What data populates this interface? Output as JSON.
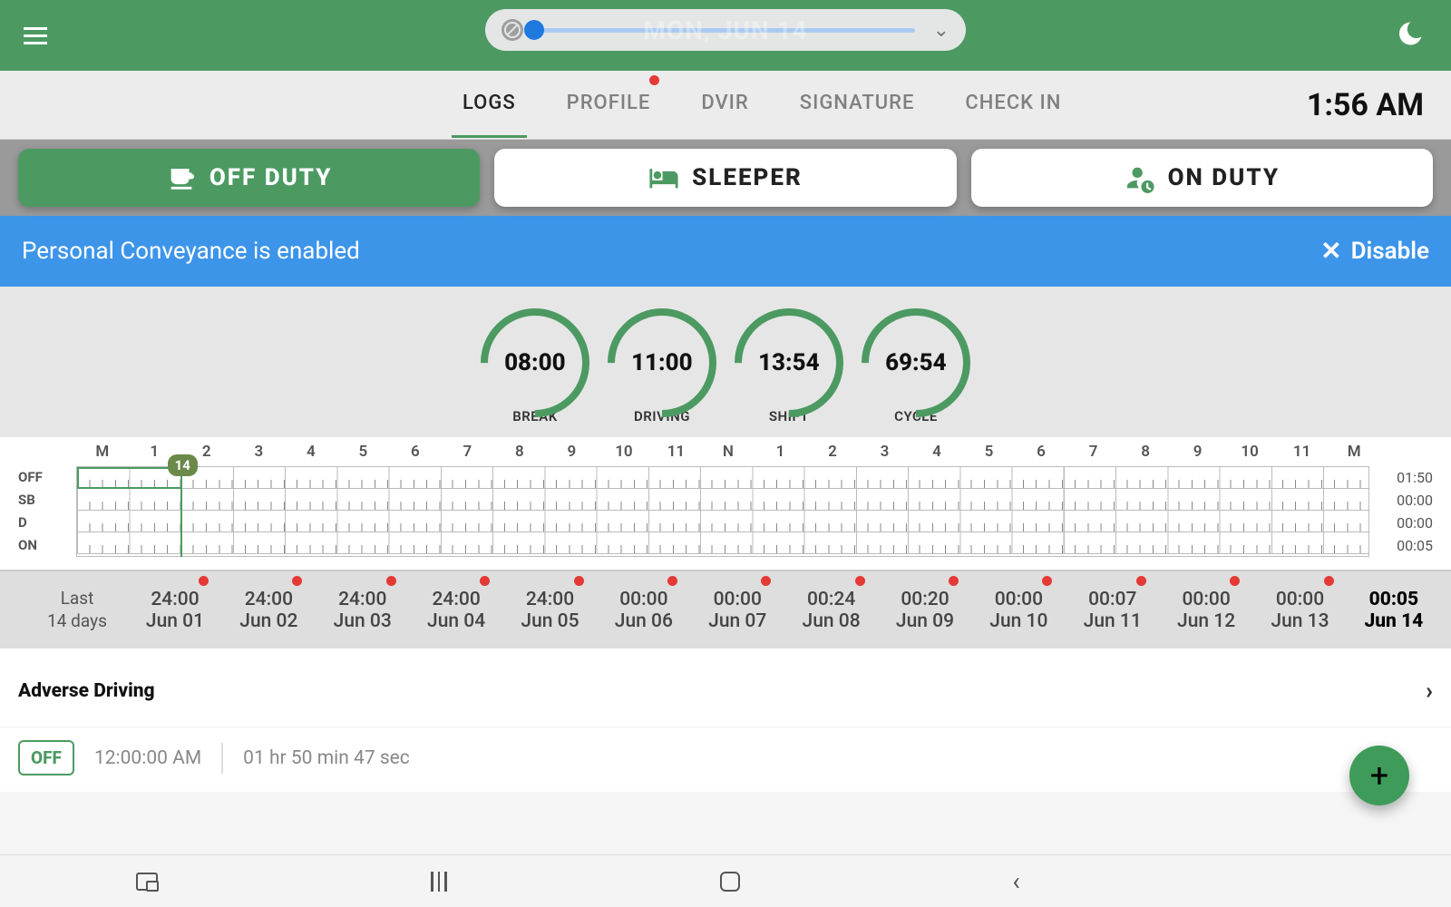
{
  "header": {
    "date_label": "MON, JUN 14"
  },
  "tabs": {
    "logs": "LOGS",
    "profile": "PROFILE",
    "dvir": "DVIR",
    "signature": "SIGNATURE",
    "checkin": "CHECK IN",
    "clock": "1:56 AM"
  },
  "status": {
    "off": "OFF DUTY",
    "sleeper": "SLEEPER",
    "on": "ON DUTY"
  },
  "banner": {
    "text": "Personal Conveyance is enabled",
    "action": "Disable"
  },
  "gauges": [
    {
      "value": "08:00",
      "label": "BREAK"
    },
    {
      "value": "11:00",
      "label": "DRIVING"
    },
    {
      "value": "13:54",
      "label": "SHIFT"
    },
    {
      "value": "69:54",
      "label": "CYCLE"
    }
  ],
  "grid": {
    "top_labels": [
      "M",
      "1",
      "2",
      "3",
      "4",
      "5",
      "6",
      "7",
      "8",
      "9",
      "10",
      "11",
      "N",
      "1",
      "2",
      "3",
      "4",
      "5",
      "6",
      "7",
      "8",
      "9",
      "10",
      "11",
      "M"
    ],
    "row_names": [
      "OFF",
      "SB",
      "D",
      "ON"
    ],
    "row_totals": [
      "01:50",
      "00:00",
      "00:00",
      "00:05"
    ],
    "badge": "14"
  },
  "strip": {
    "lead1": "Last",
    "lead2": "14 days",
    "days": [
      {
        "hrs": "24:00",
        "date": "Jun 01",
        "dot": true
      },
      {
        "hrs": "24:00",
        "date": "Jun 02",
        "dot": true
      },
      {
        "hrs": "24:00",
        "date": "Jun 03",
        "dot": true
      },
      {
        "hrs": "24:00",
        "date": "Jun 04",
        "dot": true
      },
      {
        "hrs": "24:00",
        "date": "Jun 05",
        "dot": true
      },
      {
        "hrs": "00:00",
        "date": "Jun 06",
        "dot": true
      },
      {
        "hrs": "00:00",
        "date": "Jun 07",
        "dot": true
      },
      {
        "hrs": "00:24",
        "date": "Jun 08",
        "dot": true
      },
      {
        "hrs": "00:20",
        "date": "Jun 09",
        "dot": true
      },
      {
        "hrs": "00:00",
        "date": "Jun 10",
        "dot": true
      },
      {
        "hrs": "00:07",
        "date": "Jun 11",
        "dot": true
      },
      {
        "hrs": "00:00",
        "date": "Jun 12",
        "dot": true
      },
      {
        "hrs": "00:00",
        "date": "Jun 13",
        "dot": true
      },
      {
        "hrs": "00:05",
        "date": "Jun 14",
        "dot": false,
        "current": true
      }
    ]
  },
  "section": {
    "title": "Adverse Driving"
  },
  "entry": {
    "chip": "OFF",
    "time": "12:00:00 AM",
    "duration": "01 hr 50 min 47 sec"
  },
  "fab": "+"
}
